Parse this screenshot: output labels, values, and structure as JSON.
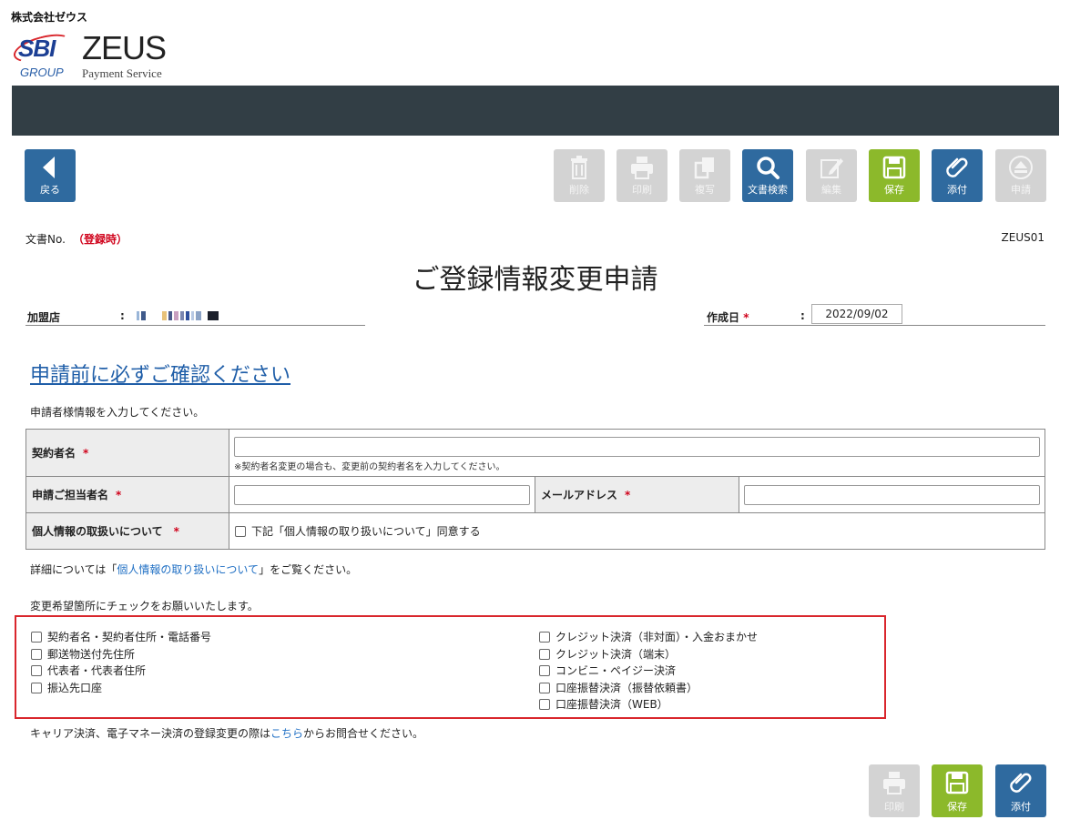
{
  "header": {
    "company": "株式会社ゼウス",
    "logo_sbi": "SBI",
    "logo_group": "GROUP",
    "logo_zeus": "ZEUS",
    "logo_payment": "Payment Service"
  },
  "toolbar": {
    "back": "戻る",
    "delete": "削除",
    "print": "印刷",
    "copy": "複写",
    "search": "文書検索",
    "edit": "編集",
    "save": "保存",
    "attach": "添付",
    "apply": "申請"
  },
  "doc": {
    "no_label": "文書No.",
    "no_value": "（登録時）",
    "code": "ZEUS01",
    "title": "ご登録情報変更申請"
  },
  "meta": {
    "member_label": "加盟店",
    "colon": ":",
    "date_label": "作成日",
    "required_mark": "*",
    "date_value": "2022/09/02"
  },
  "notice": {
    "confirm_link": "申請前に必ずご確認ください",
    "instruction": "申請者様情報を入力してください。"
  },
  "form": {
    "contract_name_label": "契約者名",
    "contract_note": "※契約者名変更の場合も、変更前の契約者名を入力してください。",
    "contact_name_label": "申請ご担当者名",
    "email_label": "メールアドレス",
    "privacy_label": "個人情報の取扱いについて",
    "privacy_agree": "下記「個人情報の取り扱いについて」同意する"
  },
  "detail": {
    "prefix": "詳細については「",
    "link": "個人情報の取り扱いについて",
    "suffix": "」をご覧ください。"
  },
  "changes": {
    "hint": "変更希望箇所にチェックをお願いいたします。",
    "left": [
      "契約者名・契約者住所・電話番号",
      "郵送物送付先住所",
      "代表者・代表者住所",
      "振込先口座"
    ],
    "right": [
      "クレジット決済（非対面）・入金おまかせ",
      "クレジット決済（端末）",
      "コンビニ・ペイジー決済",
      "口座振替決済（振替依頼書）",
      "口座振替決済（WEB）"
    ]
  },
  "carrier": {
    "prefix": "キャリア決済、電子マネー決済の登録変更の際は",
    "link": "こちら",
    "suffix": "からお問合せください。"
  },
  "bottom": {
    "print": "印刷",
    "save": "保存",
    "attach": "添付"
  },
  "colors": {
    "dark_bar": "#323e45",
    "blue_button": "#2f6a9f",
    "green_button": "#8cb92b",
    "disabled_button": "#d3d3d3",
    "required": "#d0021b",
    "highlight_box": "#d9262c"
  }
}
